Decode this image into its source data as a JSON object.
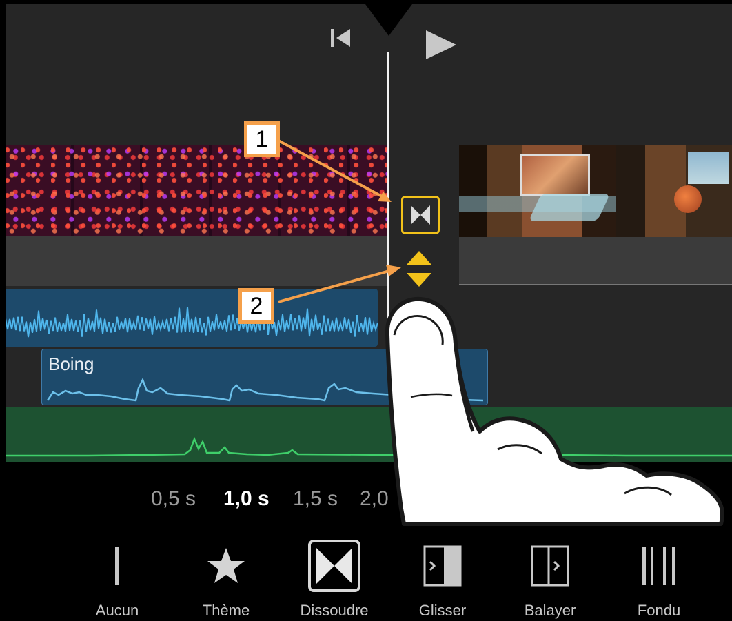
{
  "header": {
    "skip_back_icon": "skip-to-start-icon",
    "play_icon": "play-icon"
  },
  "transition_marker": {
    "icon": "dissolve-transition-icon",
    "accent": "#f2c21a"
  },
  "fine_tune_icon": "up-down-arrows-icon",
  "sound_effect": {
    "label": "Boing"
  },
  "durations": [
    {
      "label": "0,5 s",
      "selected": false
    },
    {
      "label": "1,0 s",
      "selected": true
    },
    {
      "label": "1,5 s",
      "selected": false
    },
    {
      "label": "2,0",
      "selected": false
    }
  ],
  "transitions": [
    {
      "label": "Aucun",
      "icon": "none-transition-icon"
    },
    {
      "label": "Thème",
      "icon": "star-icon"
    },
    {
      "label": "Dissoudre",
      "icon": "dissolve-icon",
      "selected": true
    },
    {
      "label": "Glisser",
      "icon": "slide-icon"
    },
    {
      "label": "Balayer",
      "icon": "wipe-icon"
    },
    {
      "label": "Fondu",
      "icon": "fade-icon"
    }
  ],
  "callouts": [
    {
      "label": "1"
    },
    {
      "label": "2"
    }
  ],
  "colors": {
    "accent_yellow": "#f2c21a",
    "callout_orange": "#f5a04a",
    "audio_blue": "#1d4a6b",
    "music_green": "#1d5231"
  }
}
